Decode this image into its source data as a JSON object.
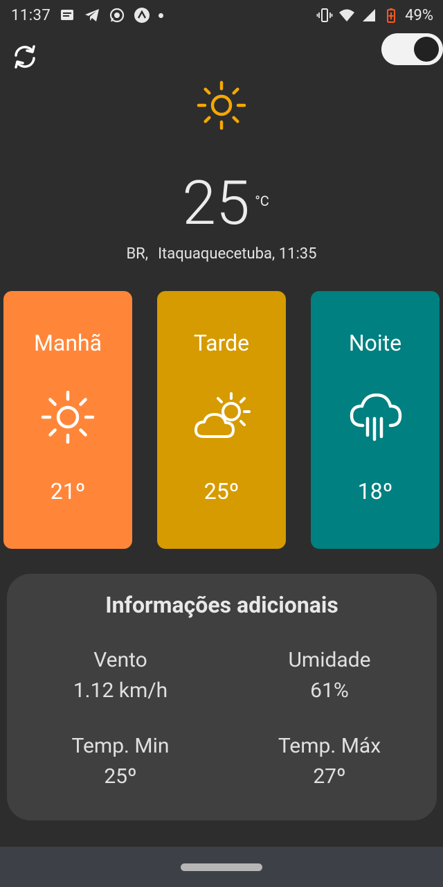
{
  "status_bar": {
    "time": "11:37",
    "battery": "49%",
    "left_icons": [
      "message-icon",
      "telegram-icon",
      "whatsapp-icon",
      "arrow-app-icon",
      "dot-icon"
    ],
    "right_icons": [
      "vibrate-icon",
      "wifi-icon",
      "signal-icon",
      "battery-charging-icon"
    ]
  },
  "header": {
    "refresh_icon": "refresh-icon",
    "theme_toggle_on": true
  },
  "current": {
    "icon": "sun-icon",
    "temperature": "25",
    "unit": "°C",
    "country": "BR,",
    "city_time": "Itaquaquecetuba, 11:35"
  },
  "periods": [
    {
      "label": "Manhã",
      "icon": "sun-icon",
      "temp": "21º",
      "color": "#ff8639"
    },
    {
      "label": "Tarde",
      "icon": "partly-cloudy-icon",
      "temp": "25º",
      "color": "#d69b00"
    },
    {
      "label": "Noite",
      "icon": "rain-cloud-icon",
      "temp": "18º",
      "color": "#008080"
    }
  ],
  "info": {
    "title": "Informações adicionais",
    "items": [
      {
        "label": "Vento",
        "value": "1.12 km/h"
      },
      {
        "label": "Umidade",
        "value": "61%"
      },
      {
        "label": "Temp. Min",
        "value": "25º"
      },
      {
        "label": "Temp. Máx",
        "value": "27º"
      }
    ]
  },
  "colors": {
    "background": "#2d2d2d",
    "sun_accent": "#f6a800",
    "info_panel": "#404040"
  }
}
